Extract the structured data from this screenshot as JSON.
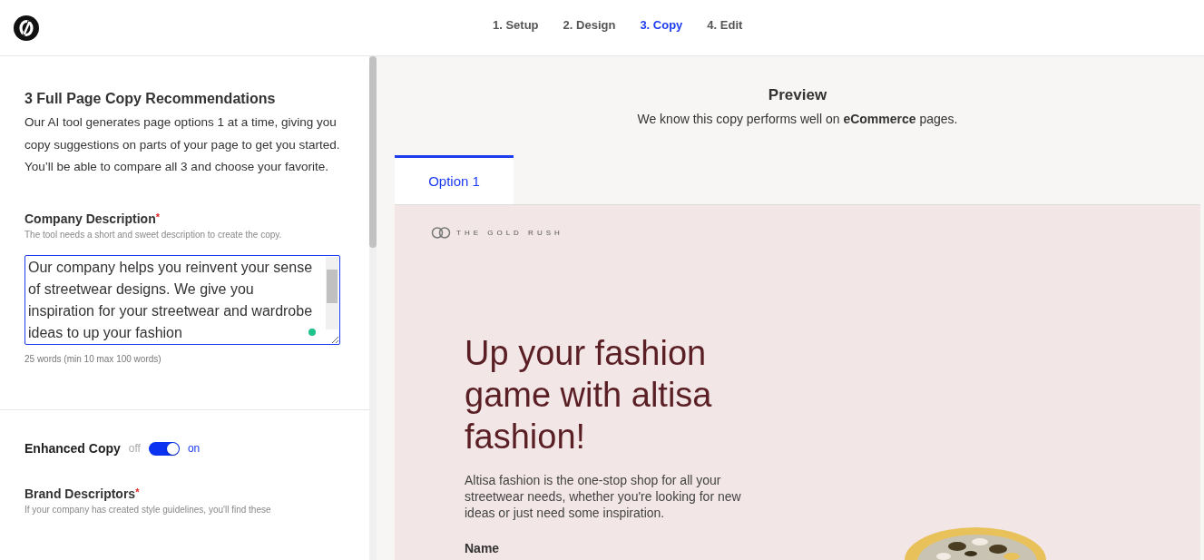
{
  "steps": [
    {
      "label": "1. Setup",
      "selected": false
    },
    {
      "label": "2. Design",
      "selected": false
    },
    {
      "label": "3. Copy",
      "selected": true
    },
    {
      "label": "4. Edit",
      "selected": false
    }
  ],
  "sidebar": {
    "title": "3 Full Page Copy Recommendations",
    "intro": "Our AI tool generates page options 1 at a time, giving you copy suggestions on parts of your page to get you started. You’ll be able to compare all 3 and choose your favorite.",
    "company_description": {
      "label": "Company Description",
      "required_mark": "*",
      "hint": "The tool needs a short and sweet description to create the copy.",
      "value": "Our company helps you reinvent your sense of streetwear designs. We give you inspiration for your streetwear and wardrobe ideas to up your fashion",
      "word_count": "25 words (min 10 max 100 words)"
    },
    "enhanced_copy": {
      "label": "Enhanced Copy",
      "off_label": "off",
      "on_label": "on",
      "on": true
    },
    "brand_descriptors": {
      "label": "Brand Descriptors",
      "required_mark": "*",
      "hint": "If your company has created style guidelines, you'll find these"
    }
  },
  "preview": {
    "title": "Preview",
    "subtitle": "We know this copy performs well on **eCommerce** pages.",
    "tabs": [
      {
        "label": "Option 1",
        "selected": true
      }
    ],
    "page": {
      "brand": "THE GOLD RUSH",
      "headline": "Up your fashion game with altisa fashion!",
      "body": "Altisa fashion is the one-stop shop for all your streetwear needs, whether you're looking for new ideas or just need some inspiration.",
      "field_label": "Name"
    }
  }
}
